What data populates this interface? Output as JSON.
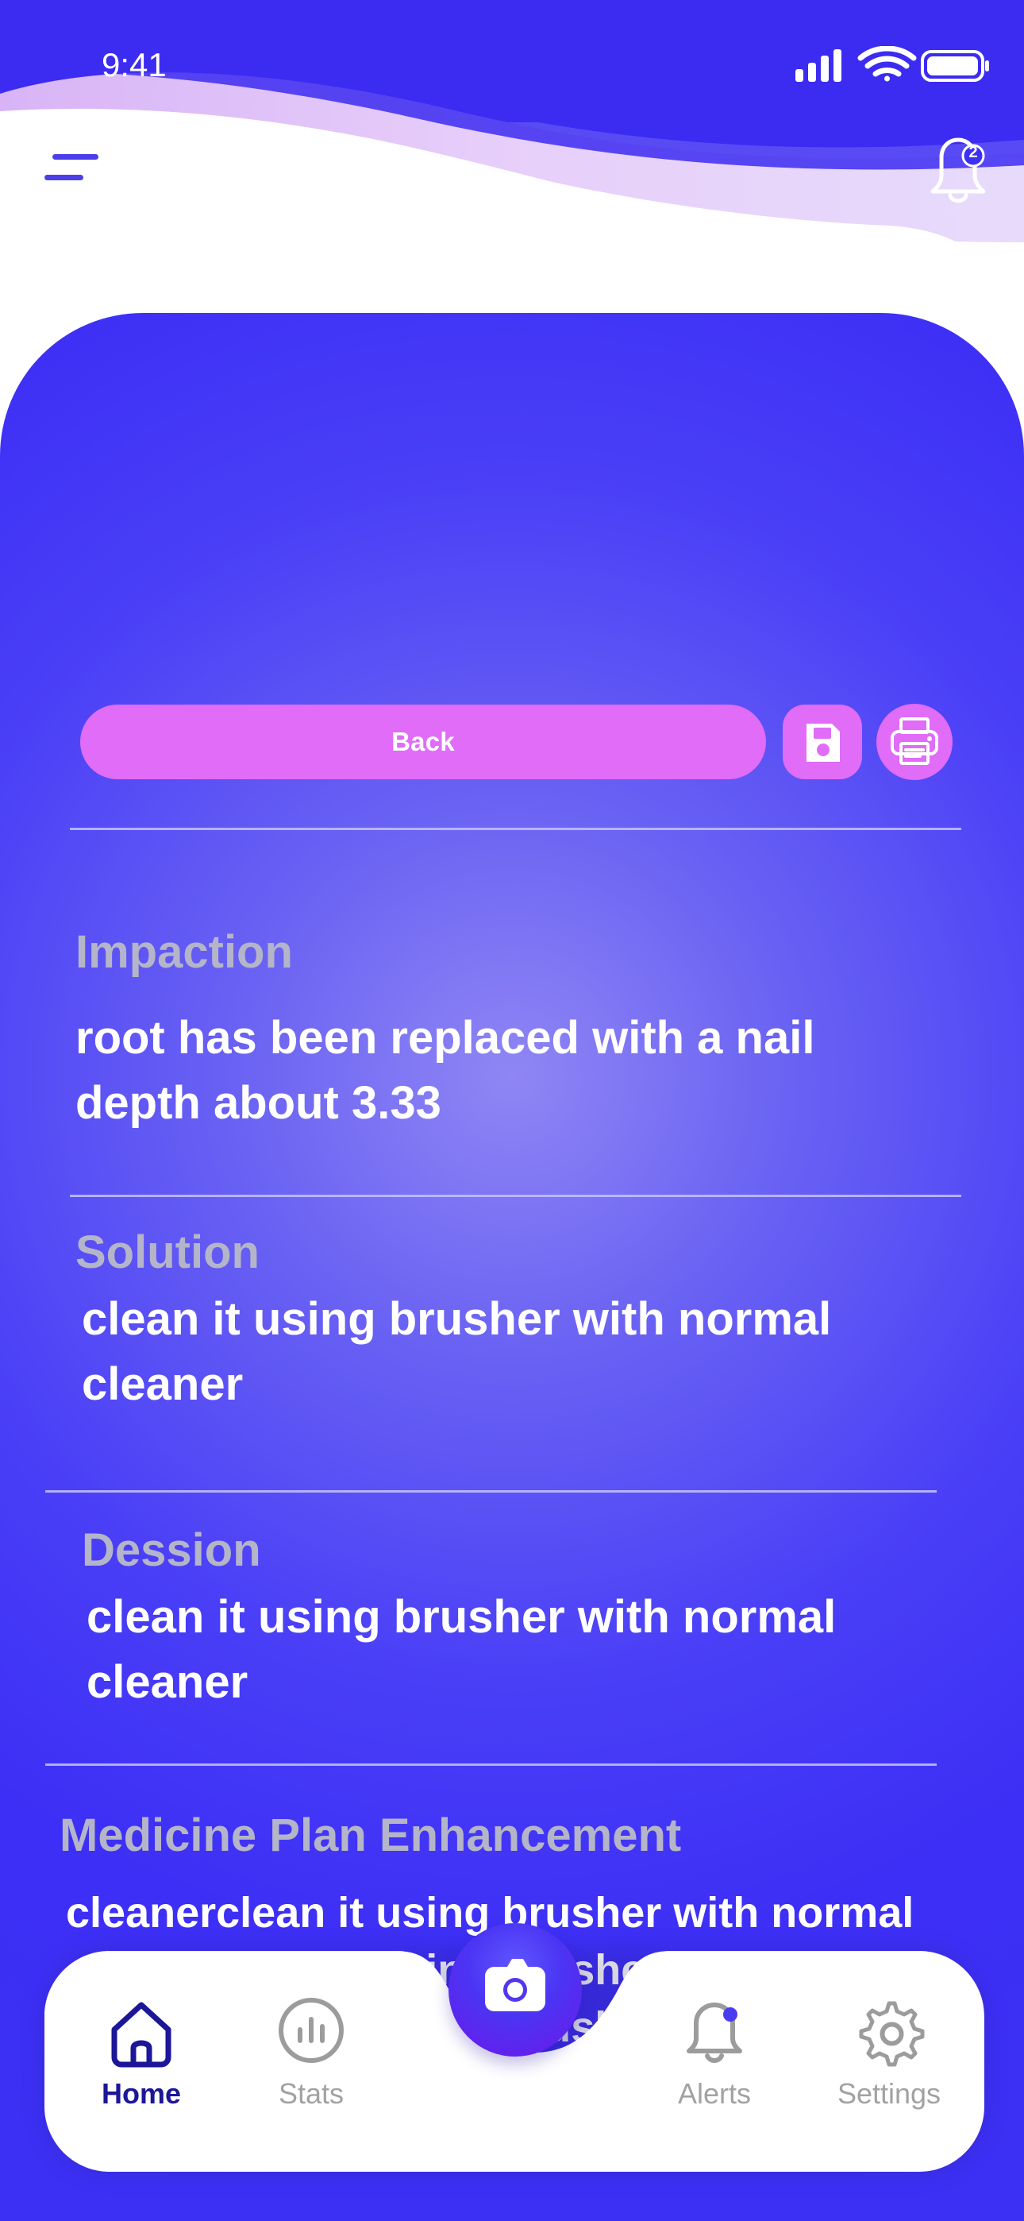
{
  "status_bar": {
    "time": "9:41"
  },
  "header": {
    "menu_icon": "hamburger-menu-icon",
    "notification_icon": "bell-icon",
    "notification_count": "2"
  },
  "actions": {
    "back_label": "Back",
    "save_icon": "save-icon",
    "print_icon": "print-icon"
  },
  "sections": [
    {
      "title": "Impaction",
      "body": "root has been replaced with a nail\ndepth about 3.33"
    },
    {
      "title": "Solution",
      "body": "clean it using brusher with normal\n cleaner"
    },
    {
      "title": "Dession",
      "body": "clean it using brusher with normal\n cleaner"
    },
    {
      "title": "Medicine Plan Enhancement",
      "body": "cleanerclean it using brusher with normal\ncleanerclean it using brusher with normal\ncleanerclean it using brusher with normal\ncleaner"
    }
  ],
  "bottom_nav": {
    "items": [
      {
        "label": "Home",
        "icon": "home-icon",
        "active": true
      },
      {
        "label": "Stats",
        "icon": "stats-icon",
        "active": false
      },
      {
        "label": "Alerts",
        "icon": "alerts-bell-icon",
        "active": false
      },
      {
        "label": "Settings",
        "icon": "settings-gear-icon",
        "active": false
      }
    ],
    "center_icon": "camera-icon"
  },
  "colors": {
    "primary": "#3c30f4",
    "accent": "#e06cf8",
    "active_nav": "#1c1698",
    "inactive_nav": "#a2a2a2"
  }
}
